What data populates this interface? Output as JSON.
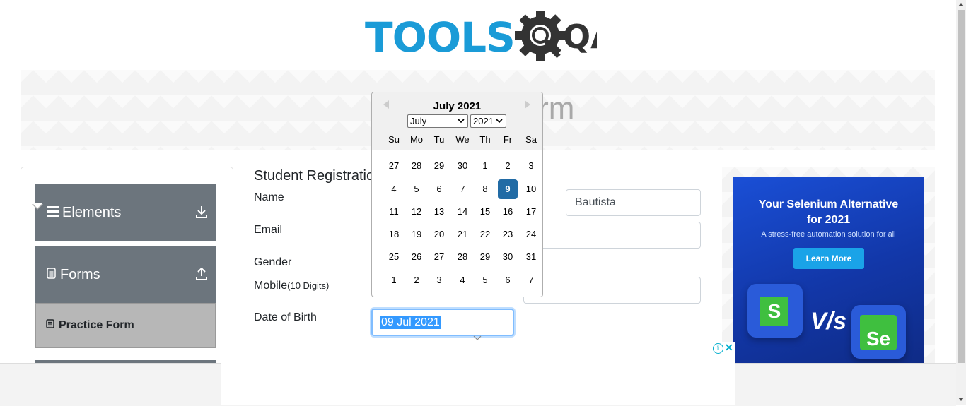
{
  "logo": {
    "text": "TOOLS",
    "suffix": "QA"
  },
  "banner": {
    "title": "Practice Form"
  },
  "sidebar": {
    "groups": [
      {
        "label": "Elements",
        "icon": "hamburger-icon",
        "toggle_icon": "download-arrow-icon"
      },
      {
        "label": "Forms",
        "icon": "document-icon",
        "toggle_icon": "upload-arrow-icon"
      }
    ],
    "active_item": {
      "label": "Practice Form",
      "icon": "form-icon"
    }
  },
  "form": {
    "title": "Student Registration Form",
    "name_label": "Name",
    "last_name_value": "Bautista",
    "email_label": "Email",
    "gender_label": "Gender",
    "mobile_label": "Mobile",
    "mobile_hint": "(10 Digits)",
    "dob_label": "Date of Birth",
    "dob_value": "09 Jul 2021"
  },
  "calendar": {
    "header": "July 2021",
    "month_select": "July",
    "year_select": "2021",
    "weekdays": [
      "Su",
      "Mo",
      "Tu",
      "We",
      "Th",
      "Fr",
      "Sa"
    ],
    "weeks": [
      [
        "27",
        "28",
        "29",
        "30",
        "1",
        "2",
        "3"
      ],
      [
        "4",
        "5",
        "6",
        "7",
        "8",
        "9",
        "10"
      ],
      [
        "11",
        "12",
        "13",
        "14",
        "15",
        "16",
        "17"
      ],
      [
        "18",
        "19",
        "20",
        "21",
        "22",
        "23",
        "24"
      ],
      [
        "25",
        "26",
        "27",
        "28",
        "29",
        "30",
        "31"
      ],
      [
        "1",
        "2",
        "3",
        "4",
        "5",
        "6",
        "7"
      ]
    ],
    "selected_day": "9",
    "selected_color": "#216ba5"
  },
  "ad": {
    "title_line1": "Your Selenium Alternative",
    "title_line2": "for 2021",
    "subtitle": "A stress-free automation solution for all",
    "button": "Learn More",
    "left_logo": "S",
    "vs": "V/s",
    "right_logo": "Se"
  },
  "colors": {
    "brand_blue": "#1a9bd7",
    "sidebar_gray": "#6c757d",
    "focus_blue": "#80bdff"
  }
}
